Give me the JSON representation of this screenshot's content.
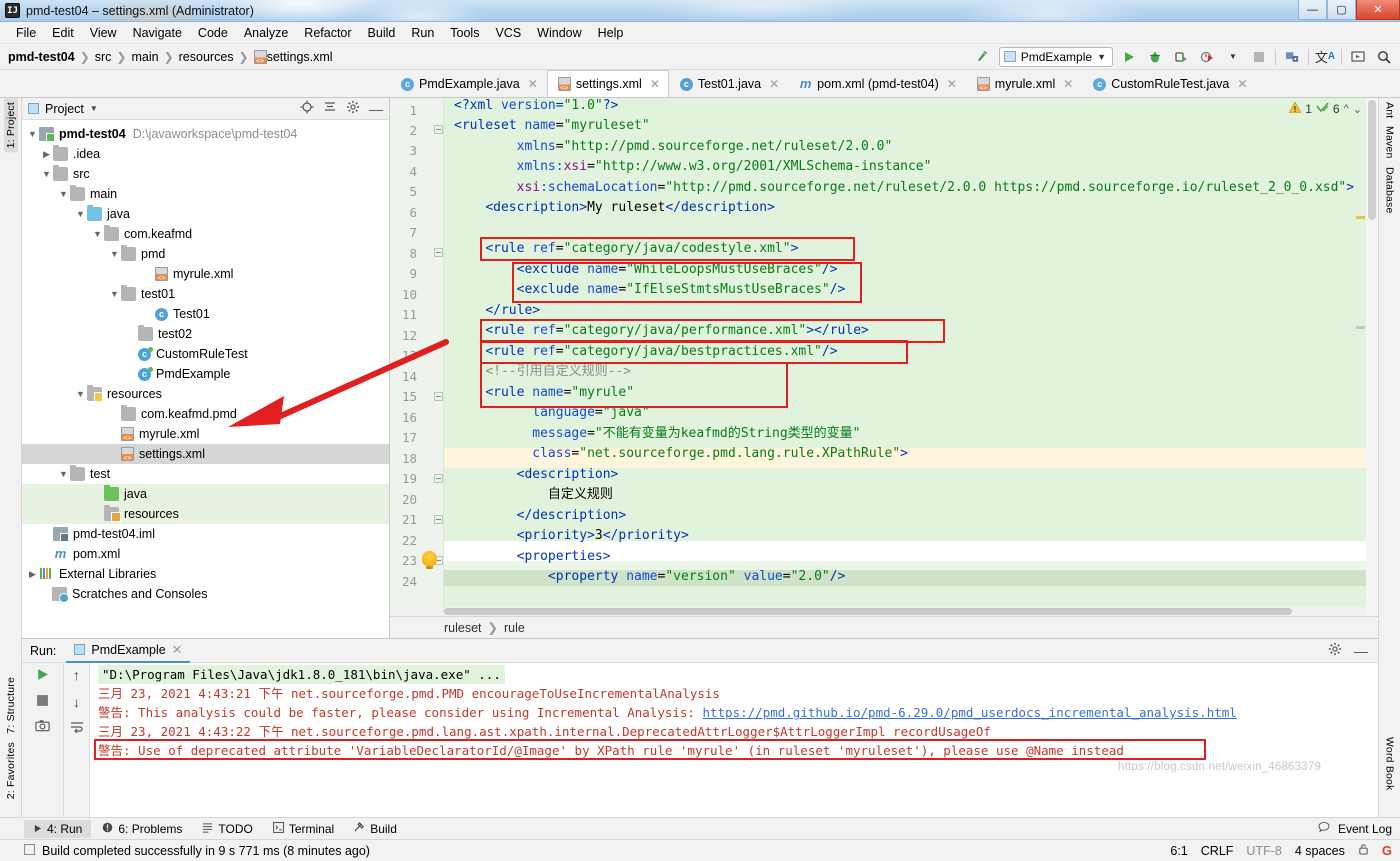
{
  "window": {
    "title": "pmd-test04 – settings.xml (Administrator)",
    "app_icon": "IJ",
    "minimize": "—",
    "maximize": "▢",
    "close": "✕"
  },
  "menubar": [
    "File",
    "Edit",
    "View",
    "Navigate",
    "Code",
    "Analyze",
    "Refactor",
    "Build",
    "Run",
    "Tools",
    "VCS",
    "Window",
    "Help"
  ],
  "breadcrumb": [
    "pmd-test04",
    "src",
    "main",
    "resources",
    "settings.xml"
  ],
  "toolbar": {
    "run_config": "PmdExample",
    "icons": [
      "update-project-icon",
      "run-icon",
      "debug-icon",
      "run-with-coverage-icon",
      "profiler-icon",
      "stop-icon",
      "project-structure-icon",
      "translate-icon",
      "presentation-icon",
      "search-everywhere-icon"
    ]
  },
  "editor_tabs": [
    {
      "label": "PmdExample.java",
      "icon": "java-class-icon",
      "active": false
    },
    {
      "label": "settings.xml",
      "icon": "xml-file-icon",
      "active": true
    },
    {
      "label": "Test01.java",
      "icon": "java-class-icon",
      "active": false
    },
    {
      "label": "pom.xml (pmd-test04)",
      "icon": "maven-icon",
      "active": false
    },
    {
      "label": "myrule.xml",
      "icon": "xml-file-icon",
      "active": false
    },
    {
      "label": "CustomRuleTest.java",
      "icon": "java-class-icon",
      "active": false
    }
  ],
  "left_rail": [
    "1: Project",
    "7: Structure",
    "2: Favorites"
  ],
  "right_rail": [
    "Ant",
    "Maven",
    "Database",
    "Word Book"
  ],
  "project_panel": {
    "title": "Project",
    "header_icons": [
      "locate-icon",
      "collapse-all-icon",
      "settings-icon",
      "hide-icon"
    ],
    "tree": [
      {
        "depth": 0,
        "arrow": "v",
        "icon": "module-icon",
        "label": "pmd-test04",
        "bold": true,
        "path": "D:\\javaworkspace\\pmd-test04"
      },
      {
        "depth": 1,
        "arrow": ">",
        "icon": "folder-icon",
        "label": ".idea"
      },
      {
        "depth": 1,
        "arrow": "v",
        "icon": "folder-icon",
        "label": "src"
      },
      {
        "depth": 2,
        "arrow": "v",
        "icon": "folder-icon",
        "label": "main"
      },
      {
        "depth": 3,
        "arrow": "v",
        "icon": "folder-source-icon",
        "label": "java"
      },
      {
        "depth": 4,
        "arrow": "v",
        "icon": "package-icon",
        "label": "com.keafmd"
      },
      {
        "depth": 5,
        "arrow": "v",
        "icon": "package-icon",
        "label": "pmd"
      },
      {
        "depth": 6,
        "arrow": "",
        "icon": "xml-file-icon",
        "label": "myrule.xml"
      },
      {
        "depth": 5,
        "arrow": "v",
        "icon": "package-icon",
        "label": "test01"
      },
      {
        "depth": 6,
        "arrow": "",
        "icon": "java-class-icon",
        "label": "Test01"
      },
      {
        "depth": 5,
        "arrow": "",
        "icon": "package-icon",
        "label": "test02"
      },
      {
        "depth": 5,
        "arrow": "",
        "icon": "java-class-run-icon",
        "label": "CustomRuleTest"
      },
      {
        "depth": 5,
        "arrow": "",
        "icon": "java-class-run-icon",
        "label": "PmdExample"
      },
      {
        "depth": 3,
        "arrow": "v",
        "icon": "folder-resources-icon",
        "label": "resources"
      },
      {
        "depth": 4,
        "arrow": "",
        "icon": "folder-icon",
        "label": "com.keafmd.pmd"
      },
      {
        "depth": 4,
        "arrow": "",
        "icon": "xml-file-icon",
        "label": "myrule.xml"
      },
      {
        "depth": 4,
        "arrow": "",
        "icon": "xml-file-icon",
        "label": "settings.xml",
        "selected": true
      },
      {
        "depth": 2,
        "arrow": "v",
        "icon": "folder-icon",
        "label": "test"
      },
      {
        "depth": 3,
        "arrow": "",
        "icon": "folder-test-source-icon",
        "label": "java",
        "green": true
      },
      {
        "depth": 3,
        "arrow": "",
        "icon": "folder-test-resources-icon",
        "label": "resources",
        "green": true
      },
      {
        "depth": 1,
        "arrow": "",
        "icon": "iml-file-icon",
        "label": "pmd-test04.iml"
      },
      {
        "depth": 1,
        "arrow": "",
        "icon": "maven-icon",
        "label": "pom.xml"
      },
      {
        "depth": 0,
        "arrow": ">",
        "icon": "libraries-icon",
        "label": "External Libraries"
      },
      {
        "depth": 0,
        "arrow": "",
        "icon": "scratches-icon",
        "label": "Scratches and Consoles"
      }
    ]
  },
  "code": {
    "first_line": 1,
    "lines": [
      {
        "n": 1,
        "text": "<?xml version=\"1.0\"?>"
      },
      {
        "n": 2,
        "text": "<ruleset name=\"myruleset\""
      },
      {
        "n": 3,
        "text": "         xmlns=\"http://pmd.sourceforge.net/ruleset/2.0.0\""
      },
      {
        "n": 4,
        "text": "         xmlns:xsi=\"http://www.w3.org/2001/XMLSchema-instance\""
      },
      {
        "n": 5,
        "text": "         xsi:schemaLocation=\"http://pmd.sourceforge.net/ruleset/2.0.0 https://pmd.sourceforge.io/ruleset_2_0_0.xsd\">"
      },
      {
        "n": 6,
        "text": "    <description>My ruleset</description>"
      },
      {
        "n": 7,
        "text": ""
      },
      {
        "n": 8,
        "text": "    <rule ref=\"category/java/codestyle.xml\">"
      },
      {
        "n": 9,
        "text": "        <exclude name=\"WhileLoopsMustUseBraces\"/>"
      },
      {
        "n": 10,
        "text": "        <exclude name=\"IfElseStmtsMustUseBraces\"/>"
      },
      {
        "n": 11,
        "text": "    </rule>"
      },
      {
        "n": 12,
        "text": "    <rule ref=\"category/java/performance.xml\"></rule>"
      },
      {
        "n": 13,
        "text": "    <rule ref=\"category/java/bestpractices.xml\"/>"
      },
      {
        "n": 14,
        "text": "    <!--引用自定义规则-->"
      },
      {
        "n": 15,
        "text": "    <rule name=\"myrule\""
      },
      {
        "n": 16,
        "text": "          language=\"java\""
      },
      {
        "n": 17,
        "text": "          message=\"不能有变量为keafmd的String类型的变量\""
      },
      {
        "n": 18,
        "text": "          class=\"net.sourceforge.pmd.lang.rule.XPathRule\">"
      },
      {
        "n": 19,
        "text": "        <description>"
      },
      {
        "n": 20,
        "text": "            自定义规则"
      },
      {
        "n": 21,
        "text": "        </description>"
      },
      {
        "n": 22,
        "text": "        <priority>3</priority>"
      },
      {
        "n": 23,
        "text": "        <properties>"
      },
      {
        "n": 24,
        "text": "            <property name=\"version\" value=\"2.0\"/>"
      }
    ],
    "inspection": {
      "warning_count": "1",
      "weak_warning_count": "6"
    },
    "breadcrumb": [
      "ruleset",
      "rule"
    ]
  },
  "run_panel": {
    "label": "Run:",
    "tab": "PmdExample",
    "rail_icons": [
      "rerun-icon",
      "stop-icon",
      "screenshot-icon",
      "up-icon",
      "down-icon",
      "soft-wrap-icon"
    ],
    "header_right_icons": [
      "settings-icon",
      "hide-icon"
    ],
    "console": [
      {
        "text": "\"D:\\Program Files\\Java\\jdk1.8.0_181\\bin\\java.exe\" ...",
        "style": "cmd"
      },
      {
        "text": "三月 23, 2021 4:43:21 下午 net.sourceforge.pmd.PMD encourageToUseIncrementalAnalysis",
        "style": "err"
      },
      {
        "text": "警告: This analysis could be faster, please consider using Incremental Analysis: ",
        "style": "err",
        "link": "https://pmd.github.io/pmd-6.29.0/pmd_userdocs_incremental_analysis.html"
      },
      {
        "text": "三月 23, 2021 4:43:22 下午 net.sourceforge.pmd.lang.ast.xpath.internal.DeprecatedAttrLogger$AttrLoggerImpl recordUsageOf",
        "style": "err"
      },
      {
        "text": "警告: Use of deprecated attribute 'VariableDeclaratorId/@Image' by XPath rule 'myrule' (in ruleset 'myruleset'), please use @Name instead",
        "style": "err",
        "boxed": true
      }
    ]
  },
  "bottom_tool_windows": [
    {
      "label": "4: Run",
      "icon": "run-icon",
      "selected": true
    },
    {
      "label": "6: Problems",
      "icon": "problems-icon",
      "selected": false
    },
    {
      "label": "TODO",
      "icon": "todo-icon",
      "selected": false
    },
    {
      "label": "Terminal",
      "icon": "terminal-icon",
      "selected": false
    },
    {
      "label": "Build",
      "icon": "build-icon",
      "selected": false
    }
  ],
  "status_bar": {
    "message": "Build completed successfully in 9 s 771 ms (8 minutes ago)",
    "event_log": "Event Log",
    "caret": "6:1",
    "line_separator": "CRLF",
    "encoding": "UTF-8",
    "indent": "4 spaces",
    "lock_icon": "lock-icon",
    "git_icon": "google-icon"
  },
  "watermark": "https://blog.csdn.net/weixin_46863379",
  "colors": {
    "editor_bg": "#e2f3dd",
    "annotation_red": "#e02020",
    "console_error": "#c0392b",
    "link_blue": "#3b6fd4",
    "accent_blue": "#4a90c2"
  }
}
